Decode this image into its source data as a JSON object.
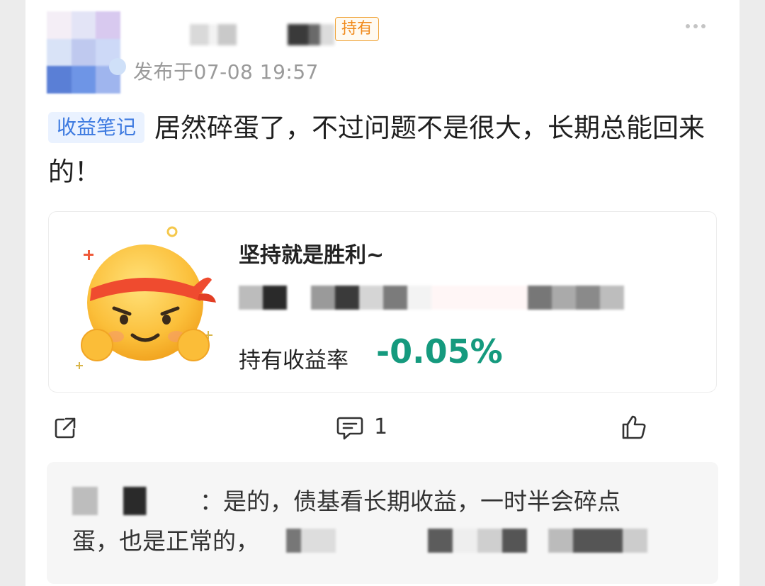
{
  "post": {
    "hold_badge": "持有",
    "time": "发布于07-08 19:57",
    "tag": "收益笔记",
    "text": "居然碎蛋了，不过问题不是很大，长期总能回来的！"
  },
  "share_card": {
    "title": "坚持就是胜利~",
    "rate_label": "持有收益率",
    "rate_value": "-0.05%",
    "rate_color": "#159a7e"
  },
  "actions": {
    "comment_count": "1",
    "icons": [
      "share-icon",
      "comment-icon",
      "like-icon",
      "more-icon"
    ]
  },
  "reply": {
    "separator": "：",
    "text_line1": "是的，债基看长期收益，一时半会碎点",
    "text_line2": "蛋，也是正常的，"
  },
  "colors": {
    "tag_bg": "#eaf2ff",
    "tag_text": "#3d7ae0",
    "hold_border": "#f0a43a"
  }
}
